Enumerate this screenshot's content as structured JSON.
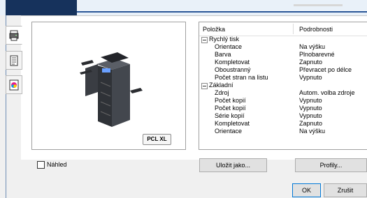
{
  "header": {},
  "sidebar": {
    "tabs": [
      {
        "icon": "printer-icon"
      },
      {
        "icon": "document-icon"
      },
      {
        "icon": "color-icon"
      }
    ]
  },
  "preview": {
    "badge": "PCL XL"
  },
  "table": {
    "columns": [
      "Položka",
      "Podrobnosti"
    ],
    "rows": [
      {
        "type": "group",
        "label": "Rychlý tisk",
        "value": ""
      },
      {
        "type": "item",
        "label": "Orientace",
        "value": "Na výšku"
      },
      {
        "type": "item",
        "label": "Barva",
        "value": "Plnobarevné"
      },
      {
        "type": "item",
        "label": "Kompletovat",
        "value": "Zapnuto"
      },
      {
        "type": "item",
        "label": "Oboustranný",
        "value": "Převracet po délce"
      },
      {
        "type": "item",
        "label": "Počet stran na listu",
        "value": "Vypnuto"
      },
      {
        "type": "group",
        "label": "Základní",
        "value": ""
      },
      {
        "type": "item",
        "label": "Zdroj",
        "value": "Autom. volba zdroje"
      },
      {
        "type": "item",
        "label": "Počet kopií",
        "value": "Vypnuto"
      },
      {
        "type": "item",
        "label": "Počet kopií",
        "value": "Vypnuto"
      },
      {
        "type": "item",
        "label": "Série kopií",
        "value": "Vypnuto"
      },
      {
        "type": "item",
        "label": "Kompletovat",
        "value": "Zapnuto"
      },
      {
        "type": "item",
        "label": "Orientace",
        "value": "Na výšku"
      }
    ]
  },
  "preview_checkbox": {
    "label": "Náhled",
    "checked": false
  },
  "buttons": {
    "save_as": "Uložit jako...",
    "profiles": "Profily...",
    "ok": "OK",
    "cancel": "Zrušit"
  },
  "colors": {
    "accent_dark": "#16325c",
    "accent_line": "#2b5797",
    "ok_border": "#0078d7"
  }
}
